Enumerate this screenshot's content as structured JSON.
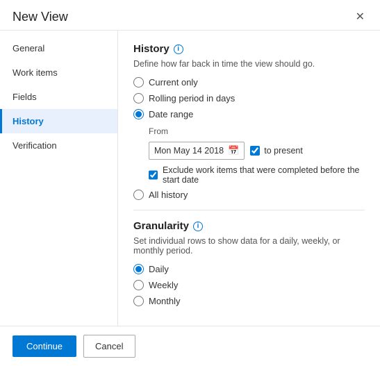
{
  "dialog": {
    "title": "New View",
    "close_label": "✕"
  },
  "sidebar": {
    "items": [
      {
        "id": "general",
        "label": "General",
        "active": false
      },
      {
        "id": "work-items",
        "label": "Work items",
        "active": false
      },
      {
        "id": "fields",
        "label": "Fields",
        "active": false
      },
      {
        "id": "history",
        "label": "History",
        "active": true
      },
      {
        "id": "verification",
        "label": "Verification",
        "active": false
      }
    ]
  },
  "content": {
    "section_title": "History",
    "section_desc": "Define how far back in time the view should go.",
    "radios": [
      {
        "id": "current-only",
        "label": "Current only",
        "checked": false
      },
      {
        "id": "rolling-period",
        "label": "Rolling period in days",
        "checked": false
      },
      {
        "id": "date-range",
        "label": "Date range",
        "checked": true
      },
      {
        "id": "all-history",
        "label": "All history",
        "checked": false
      }
    ],
    "from_label": "From",
    "date_value": "Mon May 14 2018",
    "to_present_label": "to present",
    "to_present_checked": true,
    "exclude_label": "Exclude work items that were completed before the start date",
    "exclude_checked": true,
    "granularity_title": "Granularity",
    "granularity_desc": "Set individual rows to show data for a daily, weekly, or monthly period.",
    "granularity_radios": [
      {
        "id": "daily",
        "label": "Daily",
        "checked": true
      },
      {
        "id": "weekly",
        "label": "Weekly",
        "checked": false
      },
      {
        "id": "monthly",
        "label": "Monthly",
        "checked": false
      }
    ]
  },
  "footer": {
    "continue_label": "Continue",
    "cancel_label": "Cancel"
  }
}
